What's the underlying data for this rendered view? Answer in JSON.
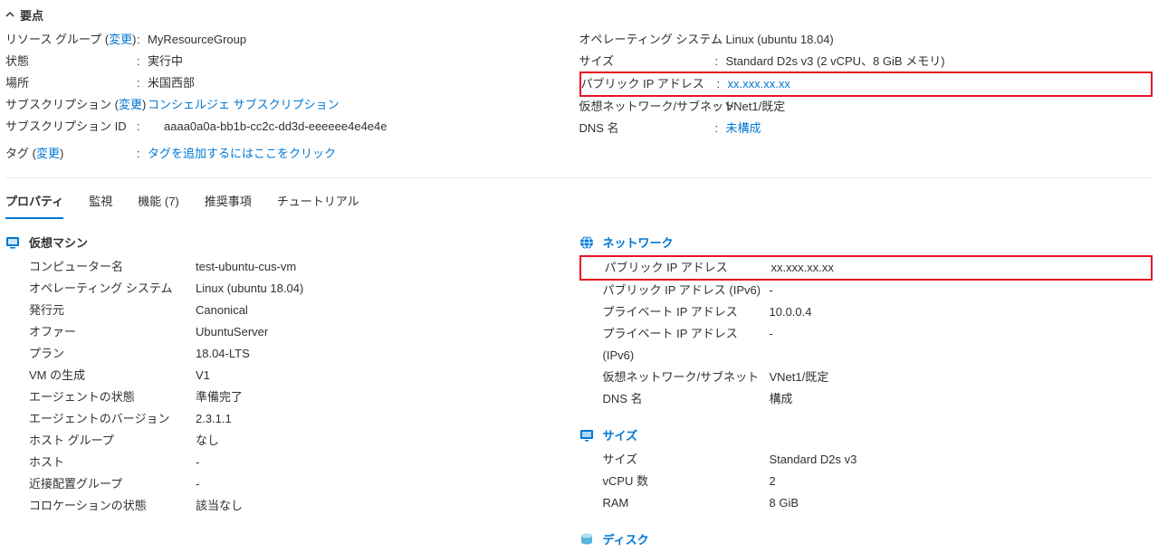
{
  "essentials": {
    "header": "要点",
    "left": {
      "resource_group_label": "リソース グループ (",
      "resource_group_change": "変更",
      "resource_group_label_end": ")",
      "resource_group_value": "MyResourceGroup",
      "status_label": "状態",
      "status_value": "実行中",
      "location_label": "場所",
      "location_value": "米国西部",
      "subscription_label": "サブスクリプション (",
      "subscription_change": "変更",
      "subscription_label_end": ")",
      "subscription_value": "コンシェルジェ サブスクリプション",
      "subscription_id_label": "サブスクリプション ID",
      "subscription_id_value": "aaaa0a0a-bb1b-cc2c-dd3d-eeeeee4e4e4e",
      "tags_label": "タグ (",
      "tags_change": "変更",
      "tags_label_end": ")",
      "tags_value": "タグを追加するにはここをクリック"
    },
    "right": {
      "os_label": "オペレーティング システム",
      "os_value": "Linux (ubuntu 18.04)",
      "size_label": "サイズ",
      "size_value": "Standard D2s v3 (2 vCPU、8 GiB メモリ)",
      "public_ip_label": "パブリック IP アドレス",
      "public_ip_value": "xx.xxx.xx.xx",
      "vnet_label": "仮想ネットワーク/サブネット",
      "vnet_value": "VNet1/既定",
      "dns_label": "DNS 名",
      "dns_value": "未構成"
    }
  },
  "tabs": {
    "properties": "プロパティ",
    "monitor": "監視",
    "features": "機能 (7)",
    "recommend": "推奨事項",
    "tutorial": "チュートリアル"
  },
  "vm": {
    "header": "仮想マシン",
    "computer_name_label": "コンピューター名",
    "computer_name_value": "test-ubuntu-cus-vm",
    "os_label": "オペレーティング システム",
    "os_value": "Linux (ubuntu 18.04)",
    "publisher_label": "発行元",
    "publisher_value": "Canonical",
    "offer_label": "オファー",
    "offer_value": "UbuntuServer",
    "plan_label": "プラン",
    "plan_value": "18.04-LTS",
    "gen_label": "VM の生成",
    "gen_value": "V1",
    "agent_status_label": "エージェントの状態",
    "agent_status_value": "準備完了",
    "agent_version_label": "エージェントのバージョン",
    "agent_version_value": "2.3.1.1",
    "host_group_label": "ホスト グループ",
    "host_group_value": "なし",
    "host_label": "ホスト",
    "host_value": "-",
    "ppg_label": "近接配置グループ",
    "ppg_value": "-",
    "colocation_label": "コロケーションの状態",
    "colocation_value": "該当なし"
  },
  "network": {
    "header": "ネットワーク",
    "public_ip_label": "パブリック IP アドレス",
    "public_ip_value": "xx.xxx.xx.xx",
    "public_ipv6_label": "パブリック IP アドレス (IPv6)",
    "public_ipv6_value": "-",
    "private_ip_label": "プライベート IP アドレス",
    "private_ip_value": "10.0.0.4",
    "private_ipv6_label": "プライベート IP アドレス (IPv6)",
    "private_ipv6_value": "-",
    "vnet_label": "仮想ネットワーク/サブネット",
    "vnet_value": "VNet1/既定",
    "dns_label": "DNS 名",
    "dns_value": "構成"
  },
  "size": {
    "header": "サイズ",
    "size_label": "サイズ",
    "size_value": "Standard D2s v3",
    "vcpu_label": "vCPU 数",
    "vcpu_value": "2",
    "ram_label": "RAM",
    "ram_value": "8 GiB"
  },
  "disk": {
    "header": "ディスク"
  }
}
